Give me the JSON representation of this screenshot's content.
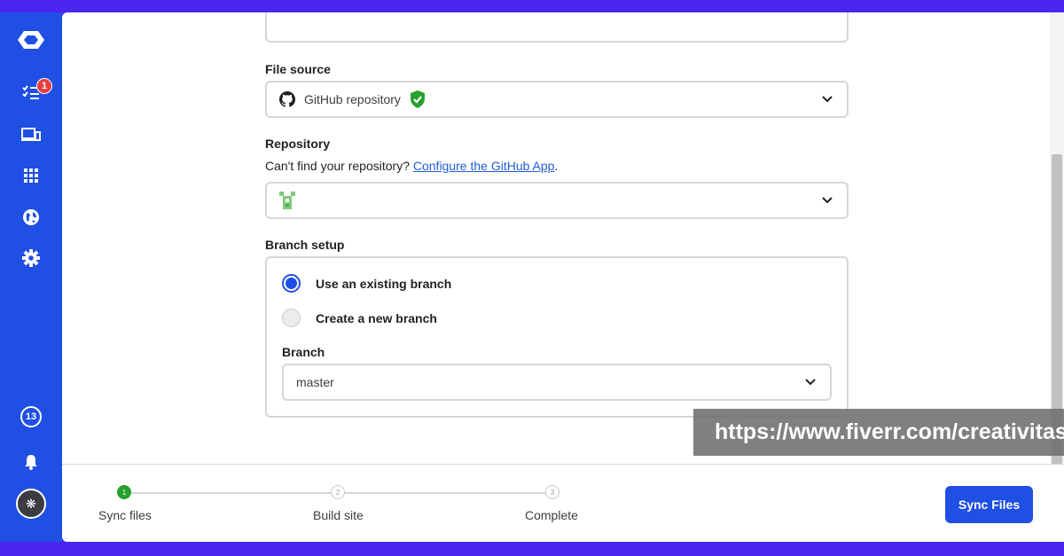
{
  "sidebar": {
    "todo_badge": "1",
    "notifications_count": "13",
    "avatar_glyph": "❋",
    "icons": [
      "logo-icon",
      "tasks-icon",
      "devices-icon",
      "grid-icon",
      "globe-icon",
      "gear-icon",
      "counter-badge",
      "bell-icon",
      "avatar"
    ]
  },
  "form": {
    "file_source_label": "File source",
    "file_source_value": "GitHub repository",
    "repository_label": "Repository",
    "repository_help": "Can't find your repository?",
    "repository_link": "Configure the GitHub App",
    "repository_help_suffix": ".",
    "branch_setup_label": "Branch setup",
    "option_existing": "Use an existing branch",
    "option_new": "Create a new branch",
    "selected_option": "existing",
    "branch_label": "Branch",
    "branch_value": "master"
  },
  "steps": [
    {
      "number": "1",
      "label": "Sync files",
      "state": "active"
    },
    {
      "number": "2",
      "label": "Build site",
      "state": "todo"
    },
    {
      "number": "3",
      "label": "Complete",
      "state": "todo"
    }
  ],
  "footer": {
    "primary_label": "Sync Files"
  },
  "watermark": "https://www.fiverr.com/creativitas",
  "colors": {
    "brand": "#1f4fe3",
    "frame": "#4b26f0",
    "success": "#27a02d",
    "link": "#1f5ed6",
    "badge": "#e53e3e"
  }
}
